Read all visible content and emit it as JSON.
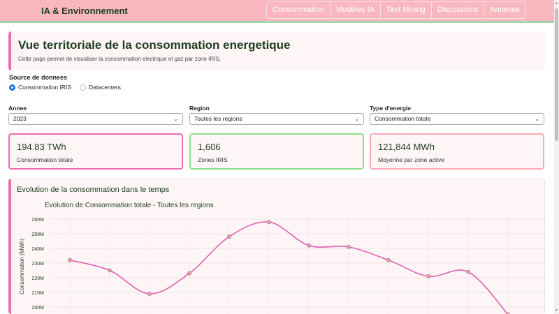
{
  "nav": {
    "brand": "IA & Environnement",
    "items": [
      "Consommation",
      "Modèles IA",
      "Text Mining",
      "Discussions",
      "Annexes"
    ]
  },
  "header": {
    "title": "Vue territoriale de la consommation energetique",
    "description": "Cette page permet de visualiser la consommation electrique et gaz par zone IRIS,"
  },
  "source": {
    "label": "Source de donnees",
    "options": [
      "Consommation IRIS",
      "Datacenters"
    ],
    "selected": 0
  },
  "filters": {
    "year": {
      "label": "Annee",
      "value": "2023"
    },
    "region": {
      "label": "Region",
      "value": "Toutes les regions"
    },
    "energy": {
      "label": "Type d'energie",
      "value": "Consommation totale"
    }
  },
  "metrics": [
    {
      "value": "194.83 TWh",
      "label": "Consommation totale",
      "color": "#f06bb1"
    },
    {
      "value": "1,606",
      "label": "Zones IRIS",
      "color": "#8ce08a"
    },
    {
      "value": "121,844 MWh",
      "label": "Moyenne par zone active",
      "color": "#f9aab7"
    }
  ],
  "chart_section": {
    "title": "Evolution de la consommation dans le temps"
  },
  "colors": {
    "accent": "#f06bb1",
    "nav_bg": "#f9b8c0",
    "nav_border": "#a5d6a7",
    "text": "#1f3d1f"
  },
  "chart_data": {
    "type": "line",
    "title": "Evolution de Consommation totale - Toutes les regions",
    "ylabel": "Consommation (MWh)",
    "xlabel": "",
    "ylim": [
      190000000,
      260000000
    ],
    "yticks": [
      "200M",
      "210M",
      "220M",
      "230M",
      "240M",
      "250M",
      "260M"
    ],
    "ytick_values": [
      200000000,
      210000000,
      220000000,
      230000000,
      240000000,
      250000000,
      260000000
    ],
    "series": [
      {
        "values": [
          232000000,
          225000000,
          209000000,
          223000000,
          248000000,
          258000000,
          242000000,
          241000000,
          232000000,
          221000000,
          224000000,
          195000000
        ]
      }
    ],
    "grid": true
  }
}
